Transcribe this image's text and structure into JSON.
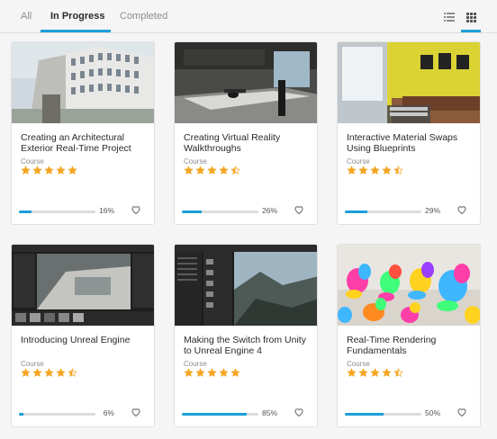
{
  "tabs": [
    {
      "label": "All"
    },
    {
      "label": "In Progress"
    },
    {
      "label": "Completed"
    }
  ],
  "active_tab": "In Progress",
  "view": {
    "list_icon": "list-icon",
    "grid_icon": "grid-icon",
    "active": "grid"
  },
  "colors": {
    "accent": "#1e9fd8",
    "star": "#f5a623",
    "star_empty": "#dcdcdc"
  },
  "courses": [
    {
      "title": "Creating an Architectural Exterior Real-Time Project",
      "type": "Course",
      "rating": 5,
      "progress": 16,
      "progress_label": "16%",
      "thumbnail": "architecture-exterior"
    },
    {
      "title": "Creating Virtual Reality Walkthroughs",
      "type": "Course",
      "rating": 4.5,
      "progress": 26,
      "progress_label": "26%",
      "thumbnail": "vr-kitchen"
    },
    {
      "title": "Interactive Material Swaps Using Blueprints",
      "type": "Course",
      "rating": 4.5,
      "progress": 29,
      "progress_label": "29%",
      "thumbnail": "living-room"
    },
    {
      "title": "Introducing Unreal Engine",
      "type": "Course",
      "rating": 4.5,
      "progress": 6,
      "progress_label": "6%",
      "thumbnail": "unreal-editor"
    },
    {
      "title": "Making the Switch from Unity to Unreal Engine 4",
      "type": "Course",
      "rating": 5,
      "progress": 85,
      "progress_label": "85%",
      "thumbnail": "editor-landscape"
    },
    {
      "title": "Real-Time Rendering Fundamentals",
      "type": "Course",
      "rating": 4.5,
      "progress": 50,
      "progress_label": "50%",
      "thumbnail": "colorful-characters"
    }
  ]
}
